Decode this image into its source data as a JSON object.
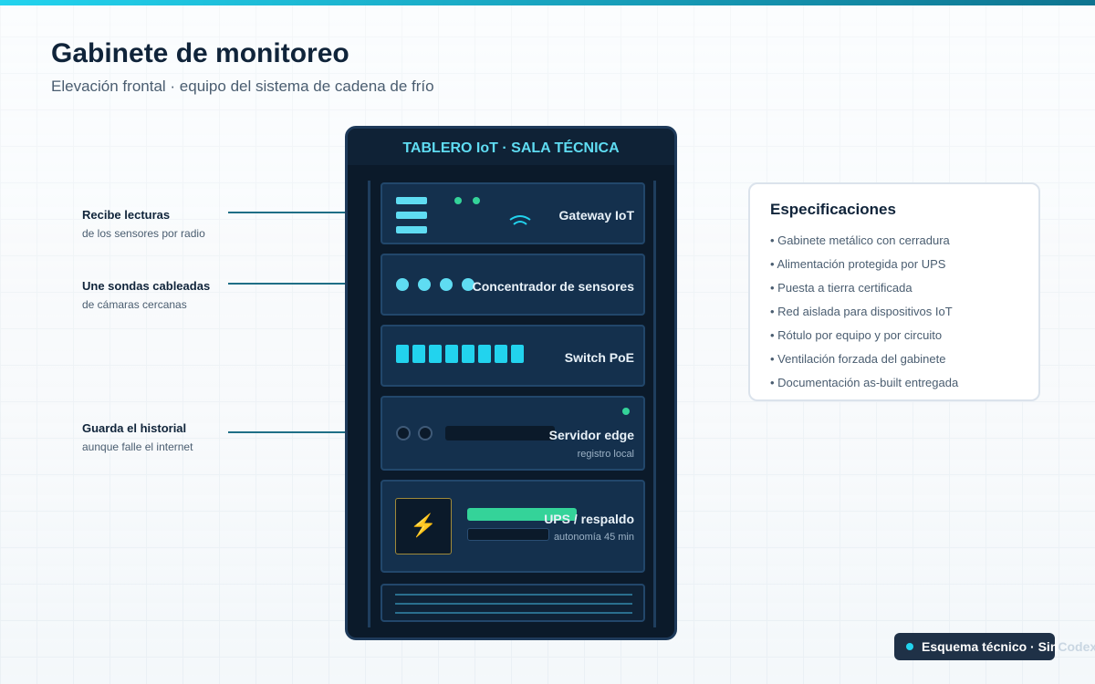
{
  "header": {
    "title": "Gabinete de monitoreo",
    "subtitle": "Elevación frontal · equipo del sistema de cadena de frío"
  },
  "callouts": [
    {
      "title": "Recibe lecturas",
      "sub": "de los sensores por radio"
    },
    {
      "title": "Une sondas cableadas",
      "sub": "de cámaras cercanas"
    },
    {
      "title": "Guarda el historial",
      "sub": "aunque falle el internet"
    }
  ],
  "cabinet": {
    "header": "TABLERO IoT · SALA TÉCNICA",
    "units": [
      {
        "label": "Gateway IoT"
      },
      {
        "label": "Concentrador de sensores"
      },
      {
        "label": "Switch PoE"
      },
      {
        "label": "Servidor edge",
        "sub": "registro local"
      },
      {
        "label": "UPS / respaldo",
        "sub": "autonomía 45 min"
      }
    ],
    "ups_icon": "lightning-bolt-icon"
  },
  "specs": {
    "title": "Especificaciones",
    "items": [
      "• Gabinete metálico con cerradura",
      "• Alimentación protegida por UPS",
      "• Puesta a tierra certificada",
      "• Red aislada para dispositivos IoT",
      "• Rótulo por equipo y por circuito",
      "• Ventilación forzada del gabinete",
      "• Documentación as-built entregada"
    ]
  },
  "footer": {
    "label": "Esquema técnico · Sin",
    "label_faded": "Codex"
  },
  "colors": {
    "accent": "#22d3ee",
    "led_green": "#34d399",
    "cabinet_bg": "#0b1a2a",
    "unit_bg": "#14304d",
    "title_color": "#10243a"
  }
}
